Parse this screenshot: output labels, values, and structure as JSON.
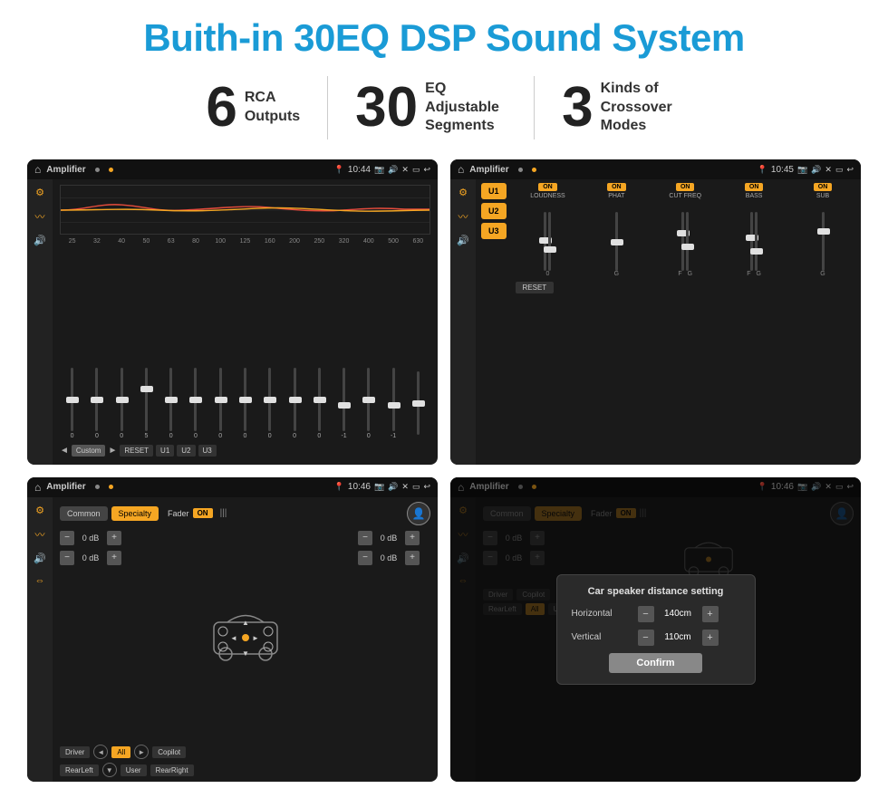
{
  "title": "Buith-in 30EQ DSP Sound System",
  "features": [
    {
      "number": "6",
      "text": "RCA\nOutputs"
    },
    {
      "number": "30",
      "text": "EQ Adjustable\nSegments"
    },
    {
      "number": "3",
      "text": "Kinds of\nCrossover Modes"
    }
  ],
  "screens": {
    "screen1": {
      "title": "Amplifier",
      "time": "10:44",
      "freqLabels": [
        "25",
        "32",
        "40",
        "50",
        "63",
        "80",
        "100",
        "125",
        "160",
        "200",
        "250",
        "320",
        "400",
        "500",
        "630"
      ],
      "sliderValues": [
        "0",
        "0",
        "0",
        "5",
        "0",
        "0",
        "0",
        "0",
        "0",
        "0",
        "0",
        "-1",
        "0",
        "-1",
        ""
      ],
      "bottomBtns": [
        "Custom",
        "RESET",
        "U1",
        "U2",
        "U3"
      ]
    },
    "screen2": {
      "title": "Amplifier",
      "time": "10:45",
      "uBtns": [
        "U1",
        "U2",
        "U3"
      ],
      "cols": [
        {
          "badge": "ON",
          "label": "LOUDNESS"
        },
        {
          "badge": "ON",
          "label": "PHAT"
        },
        {
          "badge": "ON",
          "label": "CUT FREQ"
        },
        {
          "badge": "ON",
          "label": "BASS"
        },
        {
          "badge": "ON",
          "label": "SUB"
        }
      ],
      "resetLabel": "RESET"
    },
    "screen3": {
      "title": "Amplifier",
      "time": "10:46",
      "tabs": [
        "Common",
        "Specialty"
      ],
      "activeTab": 1,
      "faderLabel": "Fader",
      "onLabel": "ON",
      "dbValues": [
        "0 dB",
        "0 dB",
        "0 dB",
        "0 dB"
      ],
      "bottomBtns": [
        "Driver",
        "All",
        "Copilot",
        "RearLeft",
        "User",
        "RearRight"
      ]
    },
    "screen4": {
      "title": "Amplifier",
      "time": "10:46",
      "tabs": [
        "Common",
        "Specialty"
      ],
      "dialog": {
        "title": "Car speaker distance setting",
        "fields": [
          {
            "label": "Horizontal",
            "value": "140cm"
          },
          {
            "label": "Vertical",
            "value": "110cm"
          }
        ],
        "confirmLabel": "Confirm"
      },
      "dbValues": [
        "0 dB",
        "0 dB"
      ],
      "bottomBtns": [
        "Driver",
        "Copilot",
        "RearLeft",
        "User",
        "RearRight"
      ]
    }
  }
}
